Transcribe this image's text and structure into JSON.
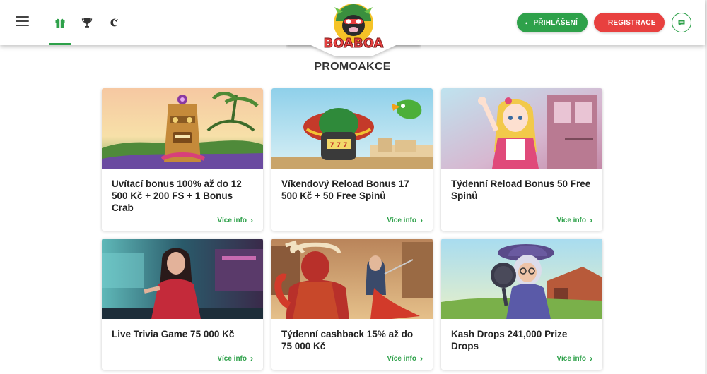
{
  "header": {
    "login_label": "PŘIHLÁŠENÍ",
    "register_label": "REGISTRACE",
    "logo_text": "BOABOA"
  },
  "page": {
    "title": "PROMOAKCE"
  },
  "promos": [
    {
      "title": "Uvítací bonus 100% až do 12 500 Kč + 200 FS + 1 Bonus Crab",
      "more": "Více info"
    },
    {
      "title": "Víkendový Reload Bonus 17 500 Kč + 50 Free Spinů",
      "more": "Více info"
    },
    {
      "title": "Týdenní Reload Bonus 50 Free Spinů",
      "more": "Více info"
    },
    {
      "title": "Live Trivia Game 75 000 Kč",
      "more": "Více info"
    },
    {
      "title": "Týdenní cashback 15% až do 75 000 Kč",
      "more": "Více info"
    },
    {
      "title": "Kash Drops 241,000 Prize Drops",
      "more": "Více info"
    }
  ],
  "colors": {
    "accent": "#2ea14a",
    "register": "#e8403f"
  }
}
